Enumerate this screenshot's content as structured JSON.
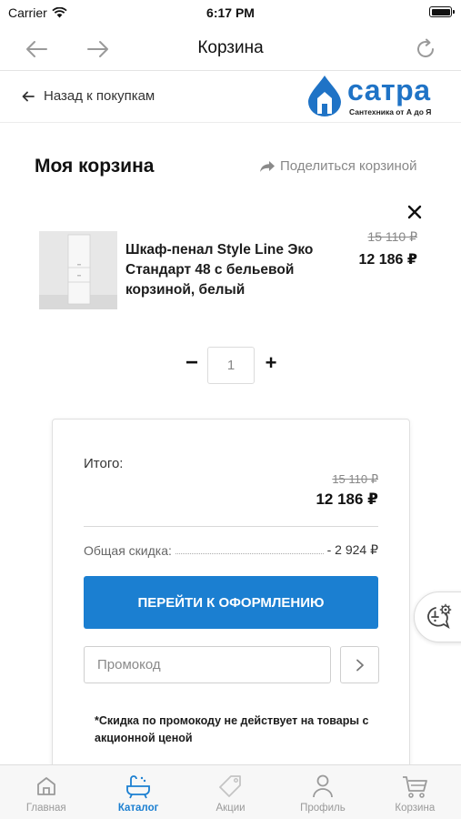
{
  "status_bar": {
    "carrier": "Carrier",
    "time": "6:17 PM"
  },
  "browser": {
    "title": "Корзина"
  },
  "header": {
    "back_label": "Назад к покупкам",
    "logo_name": "сатра",
    "logo_tagline": "Сантехника от А до Я"
  },
  "cart": {
    "title": "Моя корзина",
    "share_label": "Поделиться корзиной",
    "items": [
      {
        "name": "Шкаф-пенал Style Line Эко Стандарт 48 с бельевой корзиной, белый",
        "old_price": "15 110 ₽",
        "price": "12 186 ₽",
        "quantity": "1"
      }
    ]
  },
  "summary": {
    "total_label": "Итого:",
    "total_old": "15 110 ₽",
    "total_new": "12 186 ₽",
    "discount_label": "Общая скидка:",
    "discount_value": "- 2 924 ₽",
    "checkout_label": "ПЕРЕЙТИ К ОФОРМЛЕНИЮ",
    "promo_placeholder": "Промокод",
    "promo_note": "*Скидка по промокоду не действует на товары с акционной ценой"
  },
  "tabs": [
    {
      "label": "Главная",
      "icon": "home-icon",
      "active": false
    },
    {
      "label": "Каталог",
      "icon": "bathtub-icon",
      "active": true
    },
    {
      "label": "Акции",
      "icon": "tag-icon",
      "active": false
    },
    {
      "label": "Профиль",
      "icon": "user-icon",
      "active": false
    },
    {
      "label": "Корзина",
      "icon": "cart-icon",
      "active": false
    }
  ],
  "colors": {
    "accent": "#1b7fd1",
    "brand": "#1f73c6",
    "inactive": "#9a9a9a"
  }
}
